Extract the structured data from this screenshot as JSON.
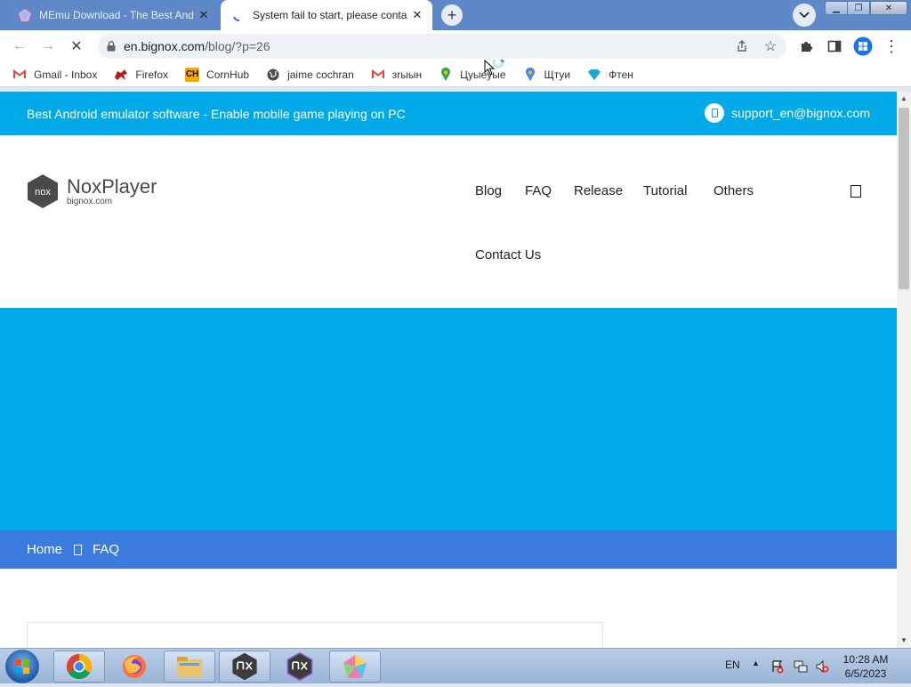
{
  "browser": {
    "tabs": [
      {
        "title": "MEmu Download - The Best Andr",
        "icon": "memu-icon",
        "active": false
      },
      {
        "title": "System fail to start, please conta",
        "icon": "loading-spinner-icon",
        "active": true
      }
    ],
    "address": {
      "host": "en.bignox.com",
      "path": "/blog/?p=26"
    },
    "bookmarks": [
      {
        "label": "Gmail - Inbox",
        "icon": "gmail-icon"
      },
      {
        "label": "Firefox",
        "icon": "firefox-icon"
      },
      {
        "label": "CornHub",
        "icon": "cornhub-icon",
        "icon_text": "CH"
      },
      {
        "label": "jaime cochran",
        "icon": "globe-icon"
      },
      {
        "label": "зrыын",
        "icon": "gmail-icon"
      },
      {
        "label": "Цуыеуые",
        "icon": "map-pin-icon"
      },
      {
        "label": "Щтуи",
        "icon": "map-pin-icon"
      },
      {
        "label": "Фтен",
        "icon": "diamond-icon"
      }
    ]
  },
  "site": {
    "tagline": "Best Android emulator software - Enable mobile game playing on PC",
    "support_email": "support_en@bignox.com",
    "logo": {
      "mark_text": "nox",
      "name": "NoxPlayer",
      "domain": "bignox.com"
    },
    "nav": [
      "Blog",
      "FAQ",
      "Release",
      "Tutorial",
      "Others",
      "Contact Us"
    ],
    "breadcrumb": [
      "Home",
      "FAQ"
    ],
    "colors": {
      "topbar": "#00aae8",
      "hero": "#00aae8",
      "breadcrumb_bar": "#3b7be0"
    }
  },
  "taskbar": {
    "apps": [
      "chrome-icon",
      "firefox-icon",
      "file-explorer-icon",
      "nox-icon",
      "nox-multi-icon",
      "memu-icon"
    ],
    "language": "EN",
    "time": "10:28 AM",
    "date": "6/5/2023"
  }
}
